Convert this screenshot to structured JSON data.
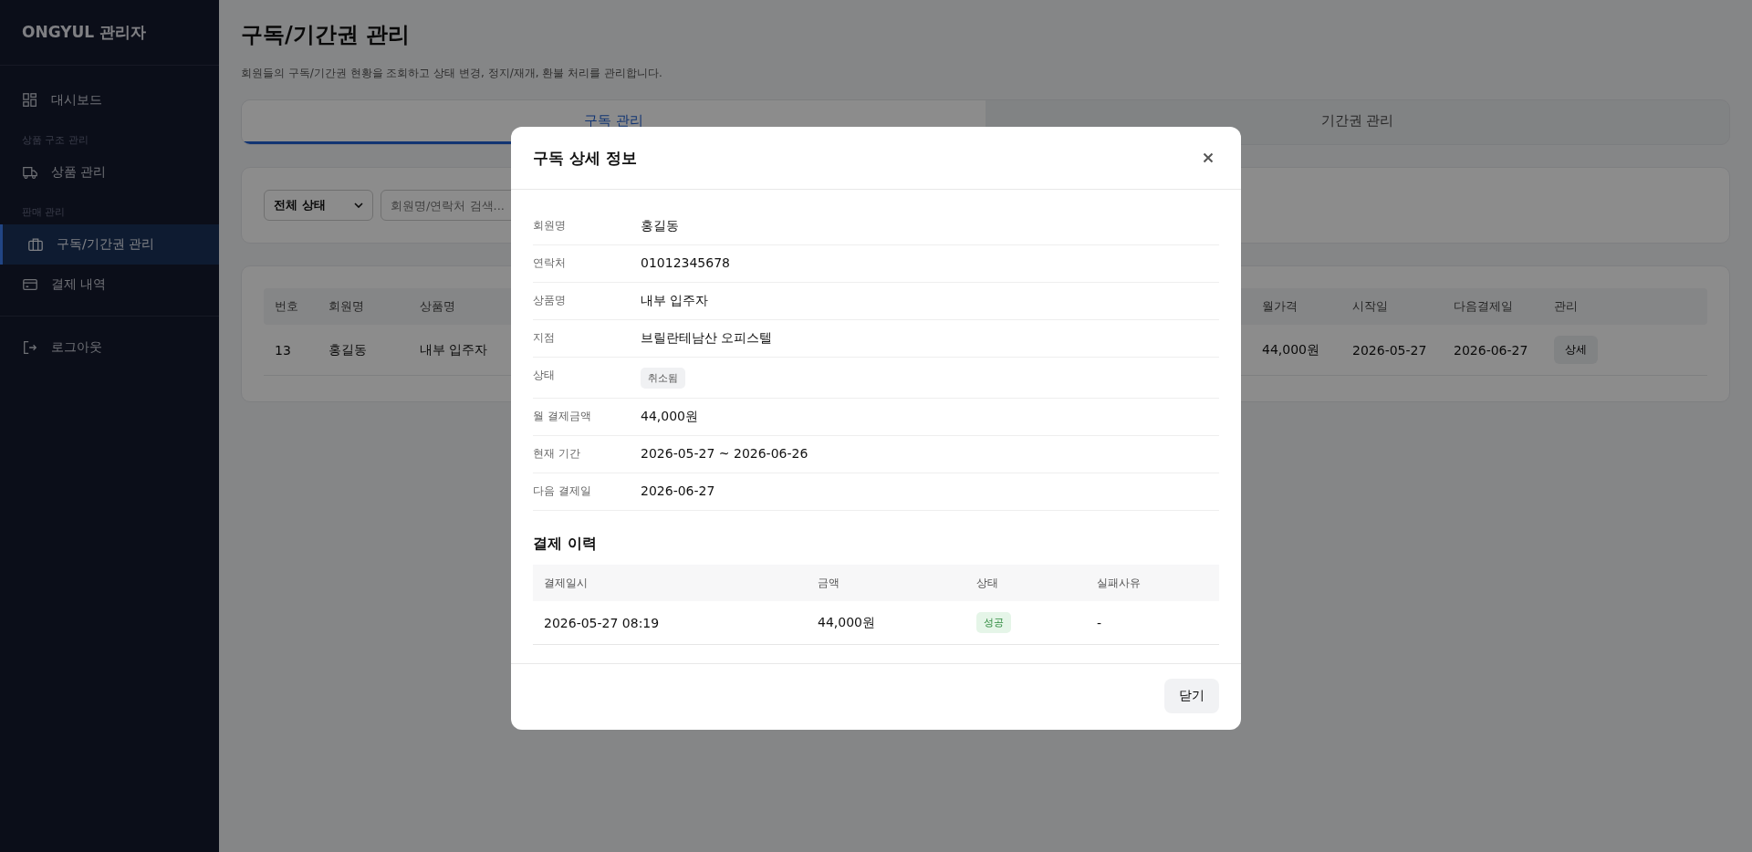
{
  "sidebar": {
    "title": "ONGYUL 관리자",
    "items": [
      {
        "kind": "link",
        "label": "대시보드",
        "selected": false
      },
      {
        "kind": "group",
        "label": "상품 구조 관리"
      },
      {
        "kind": "link",
        "label": "상품 관리",
        "selected": false
      },
      {
        "kind": "group",
        "label": "판매 관리"
      },
      {
        "kind": "link",
        "label": "구독/기간권 관리",
        "selected": true
      },
      {
        "kind": "link",
        "label": "결제 내역",
        "selected": false
      },
      {
        "kind": "divider"
      },
      {
        "kind": "link",
        "label": "로그아웃",
        "selected": false
      }
    ]
  },
  "page": {
    "title": "구독/기간권 관리",
    "subtitle": "회원들의 구독/기간권 현황을 조회하고 상태 변경, 정지/재개, 환불 처리를 관리합니다."
  },
  "tabs": [
    {
      "label": "구독 관리",
      "selected": true
    },
    {
      "label": "기간권 관리",
      "selected": false
    }
  ],
  "filter": {
    "status": "전체 상태",
    "search_placeholder": "회원명/연락처 검색..."
  },
  "table": {
    "columns": [
      "번호",
      "회원명",
      "상품명",
      "월가격",
      "시작일",
      "다음결제일",
      "관리"
    ],
    "rows": [
      {
        "cells": [
          "13",
          "홍길동",
          "내부 입주자",
          "44,000원",
          "2026-05-27",
          "2026-06-27"
        ],
        "action": "상세"
      }
    ]
  },
  "modal": {
    "title": "구독 상세 정보",
    "details": [
      {
        "label": "회원명",
        "value": "홍길동",
        "kind": "text"
      },
      {
        "label": "연락처",
        "value": "01012345678",
        "kind": "text"
      },
      {
        "label": "상품명",
        "value": "내부 입주자",
        "kind": "text"
      },
      {
        "label": "지점",
        "value": "브릴란테남산 오피스텔",
        "kind": "text"
      },
      {
        "label": "상태",
        "value": "취소됨",
        "kind": "badge"
      },
      {
        "label": "월 결제금액",
        "value": "44,000원",
        "kind": "text"
      },
      {
        "label": "현재 기간",
        "value": "2026-05-27 ~ 2026-06-26",
        "kind": "text"
      },
      {
        "label": "다음 결제일",
        "value": "2026-06-27",
        "kind": "text"
      }
    ],
    "history": {
      "title": "결제 이력",
      "columns": [
        "결제일시",
        "금액",
        "상태",
        "실패사유"
      ],
      "rows": [
        {
          "datetime": "2026-05-27 08:19",
          "amount": "44,000원",
          "status": {
            "label": "성공",
            "kind": "success"
          },
          "reason": "-"
        }
      ]
    },
    "close_button": "닫기"
  }
}
